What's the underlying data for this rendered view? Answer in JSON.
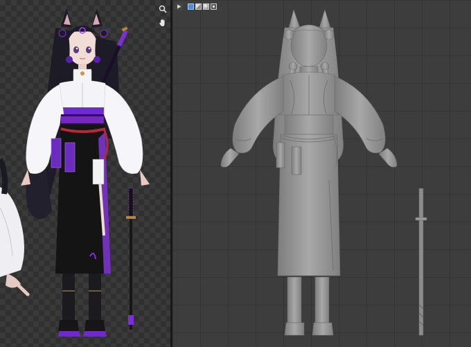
{
  "left_panel": {
    "tools": [
      {
        "name": "zoom",
        "icon": "magnifier-icon"
      },
      {
        "name": "pan",
        "icon": "hand-icon"
      }
    ]
  },
  "right_panel": {
    "header_buttons": [
      {
        "name": "play",
        "icon": "play-icon"
      },
      {
        "name": "shading-wireframe",
        "icon": "wireframe-icon"
      },
      {
        "name": "shading-solid",
        "icon": "solid-icon",
        "active": true
      },
      {
        "name": "shading-material",
        "icon": "material-icon"
      },
      {
        "name": "shading-rendered",
        "icon": "rendered-icon"
      }
    ]
  },
  "colors": {
    "accent_purple": "#8a2be2",
    "dress_white": "#f4f4f8",
    "skirt_black": "#141414",
    "clay_gray": "#9a9a9a",
    "active_blue": "#4a8de0"
  }
}
